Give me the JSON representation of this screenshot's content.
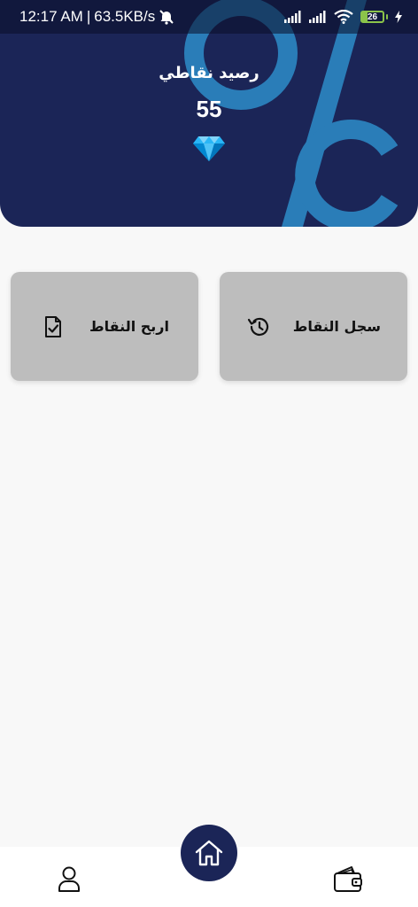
{
  "status_bar": {
    "time": "12:17 AM",
    "separator": "|",
    "speed": "63.5KB/s",
    "battery_level": "26",
    "icons": [
      "alarm-off-icon",
      "signal-icon",
      "signal-icon",
      "wifi-icon",
      "battery-icon",
      "charging-icon"
    ]
  },
  "header": {
    "title": "رصيد نقاطي",
    "points": "55",
    "decoration_icon": "percent-icon",
    "points_icon": "diamond-icon",
    "colors": {
      "background": "#1b2557",
      "decoration": "#2a7db8",
      "diamond": "#4fc3f7"
    }
  },
  "cards": {
    "history": {
      "label": "سجل النقاط",
      "icon": "history-icon"
    },
    "earn": {
      "label": "اربح النقاط",
      "icon": "document-check-icon"
    },
    "color": "#bdbdbd"
  },
  "bottom_nav": {
    "items": [
      {
        "icon": "user-icon"
      },
      {
        "icon": "home-icon"
      },
      {
        "icon": "wallet-icon"
      }
    ]
  }
}
